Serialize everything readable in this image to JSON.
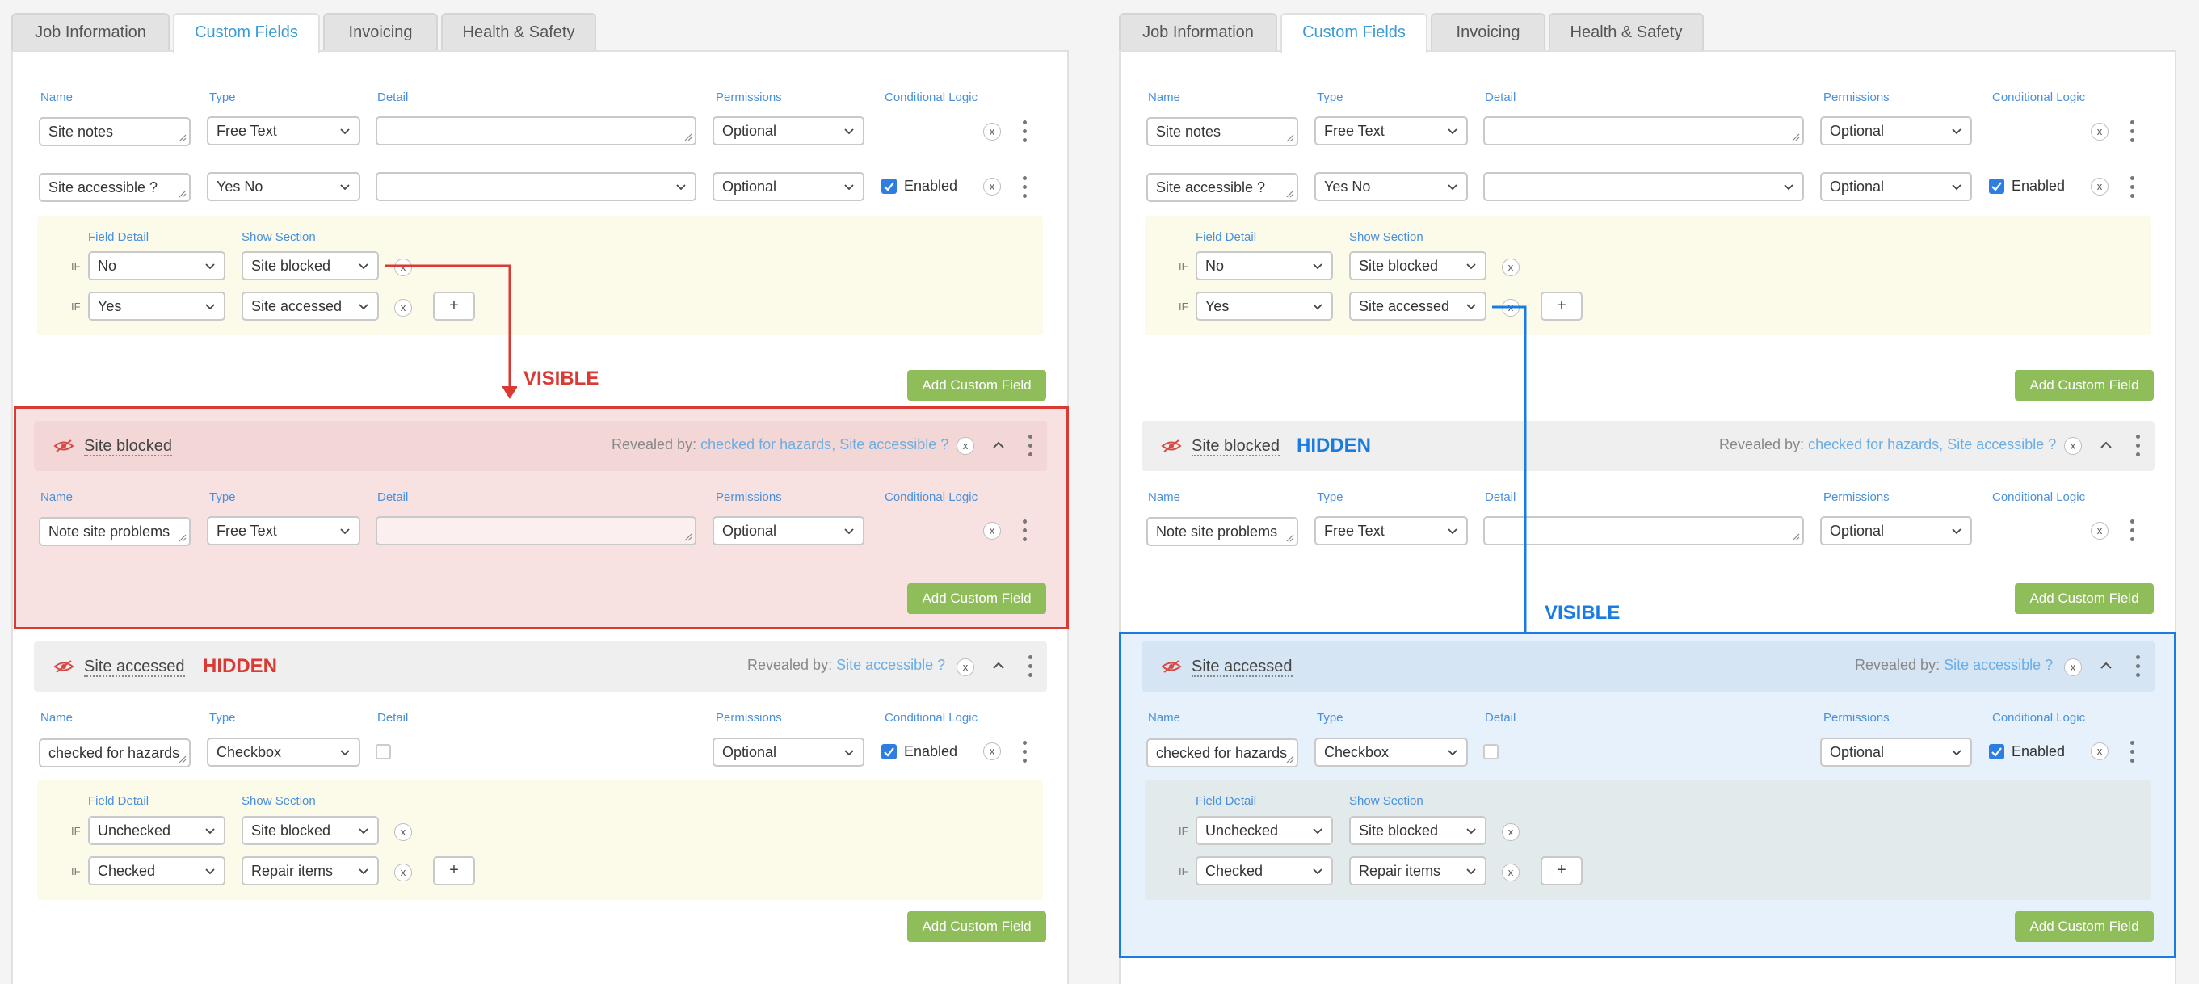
{
  "tabs": [
    "Job Information",
    "Custom Fields",
    "Invoicing",
    "Health & Safety"
  ],
  "cols": {
    "name": "Name",
    "type": "Type",
    "detail": "Detail",
    "permissions": "Permissions",
    "conditional": "Conditional Logic"
  },
  "cond_cols": {
    "field_detail": "Field Detail",
    "show_section": "Show Section"
  },
  "if_label": "IF",
  "enabled": "Enabled",
  "add_button": "Add Custom Field",
  "x": "x",
  "plus": "+",
  "revealed_by": "Revealed by:",
  "rows": {
    "site_notes": {
      "name": "Site notes",
      "type": "Free Text",
      "perm": "Optional"
    },
    "site_accessible": {
      "name": "Site accessible ?",
      "type": "Yes No",
      "perm": "Optional",
      "conds": [
        {
          "detail": "No",
          "section": "Site blocked"
        },
        {
          "detail": "Yes",
          "section": "Site accessed"
        }
      ]
    },
    "note_problems": {
      "name": "Note site problems",
      "type": "Free Text",
      "perm": "Optional"
    },
    "hazards": {
      "name": "checked for hazards",
      "type": "Checkbox",
      "perm": "Optional",
      "conds": [
        {
          "detail": "Unchecked",
          "section": "Site blocked"
        },
        {
          "detail": "Checked",
          "section": "Repair items"
        }
      ]
    }
  },
  "sections": {
    "blocked": {
      "title": "Site blocked",
      "links": [
        "checked for hazards",
        ", ",
        "Site accessible ?"
      ]
    },
    "accessed": {
      "title": "Site accessed",
      "links": [
        "Site accessible ?"
      ]
    }
  },
  "annotations": {
    "visible": "VISIBLE",
    "hidden": "HIDDEN"
  },
  "colors": {
    "accent": "#3b9bd6",
    "label": "#4a90d9",
    "add_button": "#8fbd5a",
    "red": "#d93a33",
    "blue": "#1a7ce0",
    "cond_bg": "#fcfbe9"
  }
}
